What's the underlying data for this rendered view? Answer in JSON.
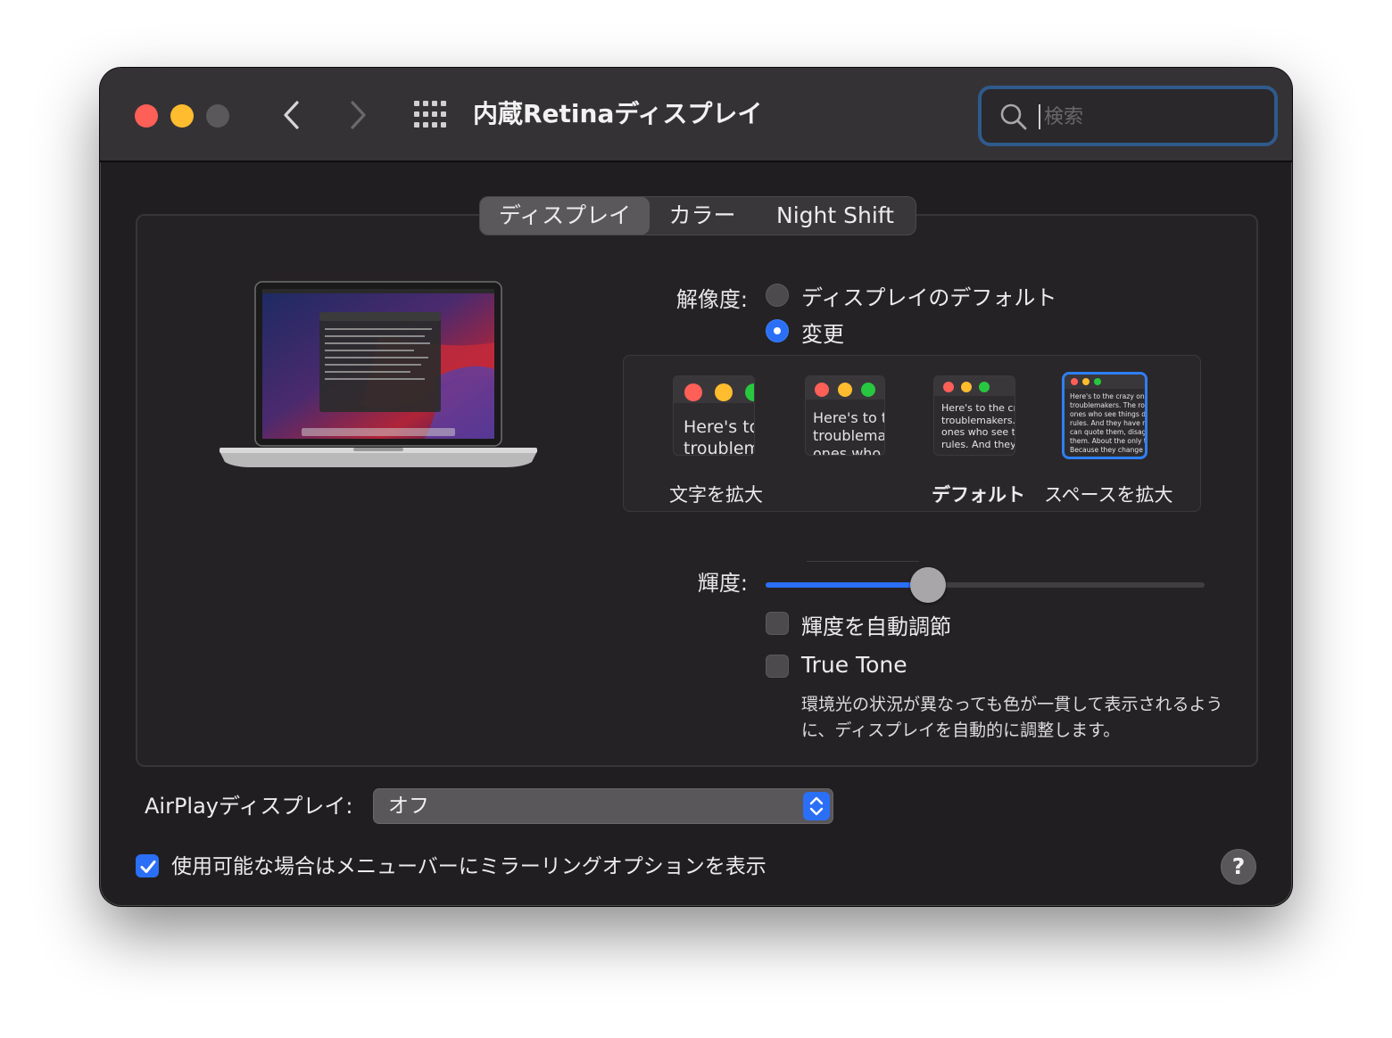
{
  "window": {
    "title": "内蔵Retinaディスプレイ",
    "search_placeholder": "検索"
  },
  "tabs": [
    {
      "label": "ディスプレイ",
      "active": true
    },
    {
      "label": "カラー",
      "active": false
    },
    {
      "label": "Night Shift",
      "active": false
    }
  ],
  "resolution": {
    "label": "解像度:",
    "options": [
      {
        "label": "ディスプレイのデフォルト",
        "selected": false
      },
      {
        "label": "変更",
        "selected": true
      }
    ],
    "previews": [
      {
        "text": "Here's to\ntroublem",
        "caption": "文字を拡大"
      },
      {
        "text": "Here's to t\ntroublema\nones who",
        "caption": ""
      },
      {
        "text": "Here's to the cr\ntroublemakers.\nones who see t\nrules. And they",
        "caption": "デフォルト"
      },
      {
        "text": "Here's to the crazy one\ntroublemakers. The rou\nones who see things dif\nrules. And they have no\ncan quote them, disagre\nthem. About the only th\nBecause they change t",
        "caption": "スペースを拡大",
        "selected": true
      }
    ]
  },
  "brightness": {
    "label": "輝度:",
    "value": 0.37,
    "auto_label": "輝度を自動調節",
    "auto_checked": false
  },
  "true_tone": {
    "label": "True Tone",
    "checked": false,
    "description": "環境光の状況が異なっても色が一貫して表示されるように、ディスプレイを自動的に調整します。"
  },
  "airplay": {
    "label": "AirPlayディスプレイ:",
    "value": "オフ"
  },
  "mirroring": {
    "label": "使用可能な場合はメニューバーにミラーリングオプションを表示",
    "checked": true
  },
  "help": {
    "label": "?"
  },
  "colors": {
    "accent": "#2a6ff5",
    "window_bg": "#211e21",
    "titlebar_bg": "#353235",
    "close": "#fe5f57",
    "minimize": "#febc2e"
  }
}
